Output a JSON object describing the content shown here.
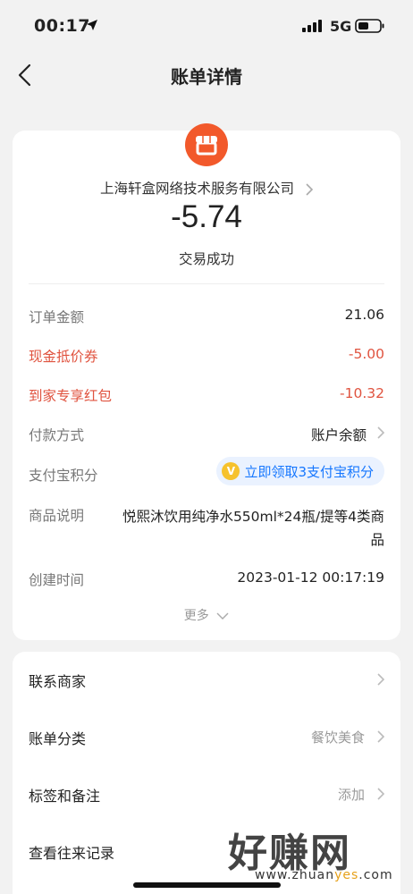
{
  "status_bar": {
    "time": "00:17",
    "network": "5G"
  },
  "nav": {
    "title": "账单详情"
  },
  "summary": {
    "merchant_name": "上海轩盒网络技术服务有限公司",
    "amount": "-5.74",
    "status": "交易成功"
  },
  "details": {
    "order_amount": {
      "label": "订单金额",
      "value": "21.06"
    },
    "cash_coupon": {
      "label": "现金抵价券",
      "value": "-5.00"
    },
    "red_packet": {
      "label": "到家专享红包",
      "value": "-10.32"
    },
    "payment_method": {
      "label": "付款方式",
      "value": "账户余额"
    },
    "alipay_points": {
      "label": "支付宝积分",
      "action": "立即领取3支付宝积分",
      "badge": "V"
    },
    "description": {
      "label": "商品说明",
      "value": "悦熙沐饮用纯净水550ml*24瓶/提等4类商品"
    },
    "created_time": {
      "label": "创建时间",
      "value": "2023-01-12 00:17:19"
    },
    "more": "更多"
  },
  "actions": {
    "contact": {
      "label": "联系商家"
    },
    "category": {
      "label": "账单分类",
      "value": "餐饮美食"
    },
    "tags": {
      "label": "标签和备注",
      "value": "添加"
    },
    "history": {
      "label": "查看往来记录"
    }
  },
  "watermark": {
    "big": "好赚网",
    "small_prefix": "www.zhuan",
    "small_highlight": "yes",
    "small_suffix": ".com"
  },
  "colors": {
    "accent_red": "#e0533f",
    "link_blue": "#1677ff",
    "merchant_orange": "#f2592b"
  }
}
